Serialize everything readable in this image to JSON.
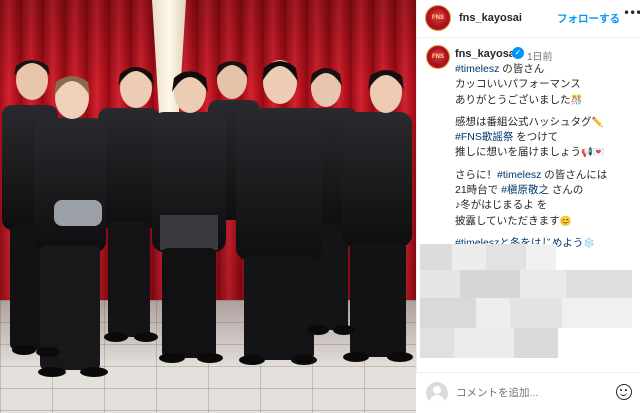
{
  "post": {
    "username": "fns_kayosai",
    "follow_label": "フォローする",
    "more_label": "•••",
    "time": "1日前",
    "avatar_text": "FNS",
    "verified_icon": "✓"
  },
  "caption": {
    "l1_tag": "#timelesz",
    "l1_text": " の皆さん",
    "l2": "カッコいいパフォーマンス",
    "l3_text": "ありがとうございました",
    "l3_emoji": "🎊",
    "l4": "感想は番組公式ハッシュタグ",
    "l4_emoji": "✏️",
    "l5_tag": "#FNS歌謡祭",
    "l5_text": " をつけて",
    "l6_text": "推しに想いを届けましょう",
    "l6_emoji": "📢💌",
    "l7": "さらに！",
    "l7_tag": "#timelesz",
    "l7_text": " の皆さんには",
    "l8_text": "21時台で ",
    "l8_tag": "#槇原敬之",
    "l8_text2": " さんの",
    "l9": "♪冬がはじまるよ を",
    "l10_text": "披露していただきます",
    "l10_emoji": "😊",
    "l11_tag": "#timeleszと冬をはじめよう",
    "l11_emoji": "❄️"
  },
  "comment": {
    "placeholder": "コメントを追加..."
  },
  "colors": {
    "link": "#00376b",
    "follow": "#0095f6",
    "curtain": "#c41a26"
  }
}
